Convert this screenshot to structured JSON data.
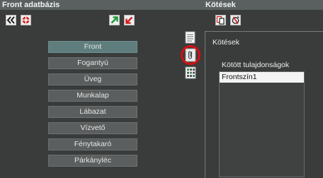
{
  "left_panel": {
    "title": "Front adatbázis",
    "items": [
      {
        "label": "Front",
        "selected": true
      },
      {
        "label": "Fogantyú",
        "selected": false
      },
      {
        "label": "Üveg",
        "selected": false
      },
      {
        "label": "Munkalap",
        "selected": false
      },
      {
        "label": "Lábazat",
        "selected": false
      },
      {
        "label": "Vízvető",
        "selected": false
      },
      {
        "label": "Fénytakaró",
        "selected": false
      },
      {
        "label": "Párkányléc",
        "selected": false
      }
    ]
  },
  "right_panel": {
    "title": "Kötések",
    "group_title": "Kötések",
    "bound_properties_label": "Kötött tulajdonságok",
    "properties": [
      "Frontszín1"
    ]
  },
  "icons": {
    "back": "double-chevron-left-icon",
    "lifebuoy": "lifebuoy-icon",
    "export": "green-arrow-up-right-icon",
    "import": "red-arrow-down-left-icon",
    "copy": "copy-icon",
    "no_link": "no-link-icon",
    "list_view": "list-view-icon",
    "paperclip": "paperclip-icon",
    "grid_view": "grid-view-icon"
  },
  "colors": {
    "highlight": "#d80f12",
    "selected_item": "#5f7d7d",
    "export_arrow": "#1e9a3a",
    "import_arrow": "#d31d1d"
  }
}
